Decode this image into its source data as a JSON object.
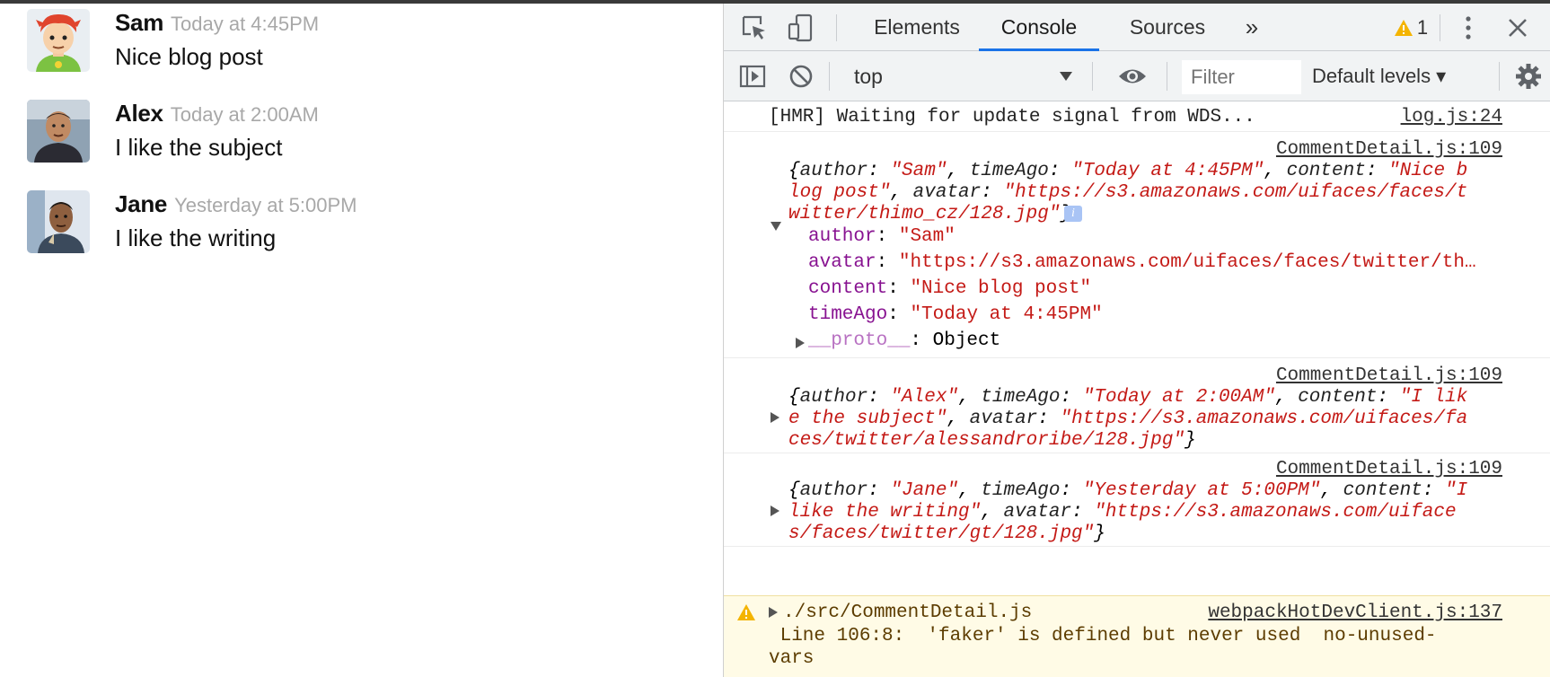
{
  "comments": [
    {
      "author": "Sam",
      "date": "Today at 4:45PM",
      "text": "Nice blog post"
    },
    {
      "author": "Alex",
      "date": "Today at 2:00AM",
      "text": "I like the subject"
    },
    {
      "author": "Jane",
      "date": "Yesterday at 5:00PM",
      "text": "I like the writing"
    }
  ],
  "devtools": {
    "tabs": [
      "Elements",
      "Console",
      "Sources"
    ],
    "more_tabs": "»",
    "warning_count": "1",
    "context": "top",
    "filter_placeholder": "Filter",
    "levels": "Default levels ▾",
    "accent": "#1a73e8"
  },
  "console": {
    "hmr": {
      "text": "[HMR] Waiting for update signal from WDS...",
      "source": "log.js:24"
    },
    "entries": [
      {
        "source": "CommentDetail.js:109",
        "lines": [
          [
            [
              "it",
              "{"
            ],
            [
              "itk",
              "author"
            ],
            [
              "it",
              ": "
            ],
            [
              "its",
              "\"Sam\""
            ],
            [
              "it",
              ", "
            ],
            [
              "itk",
              "timeAgo"
            ],
            [
              "it",
              ": "
            ],
            [
              "its",
              "\"Today at 4:45PM\""
            ],
            [
              "it",
              ", "
            ],
            [
              "itk",
              "content"
            ],
            [
              "it",
              ": "
            ],
            [
              "its",
              "\"Nice b"
            ]
          ],
          [
            [
              "its",
              "log post\""
            ],
            [
              "it",
              ", "
            ],
            [
              "itk",
              "avatar"
            ],
            [
              "it",
              ": "
            ],
            [
              "its",
              "\"https://s3.amazonaws.com/uifaces/faces/t"
            ]
          ],
          [
            [
              "its",
              "witter/thimo_cz/128.jpg\""
            ],
            [
              "it",
              "}"
            ]
          ]
        ],
        "expanded": true,
        "props": [
          {
            "key": "author",
            "value": "\"Sam\""
          },
          {
            "key": "avatar",
            "value": "\"https://s3.amazonaws.com/uifaces/faces/twitter/th…"
          },
          {
            "key": "content",
            "value": "\"Nice blog post\""
          },
          {
            "key": "timeAgo",
            "value": "\"Today at 4:45PM\""
          }
        ],
        "proto": {
          "key": "__proto__",
          "value": ": Object"
        }
      },
      {
        "source": "CommentDetail.js:109",
        "lines": [
          [
            [
              "it",
              "{"
            ],
            [
              "itk",
              "author"
            ],
            [
              "it",
              ": "
            ],
            [
              "its",
              "\"Alex\""
            ],
            [
              "it",
              ", "
            ],
            [
              "itk",
              "timeAgo"
            ],
            [
              "it",
              ": "
            ],
            [
              "its",
              "\"Today at 2:00AM\""
            ],
            [
              "it",
              ", "
            ],
            [
              "itk",
              "content"
            ],
            [
              "it",
              ": "
            ],
            [
              "its",
              "\"I lik"
            ]
          ],
          [
            [
              "its",
              "e the subject\""
            ],
            [
              "it",
              ", "
            ],
            [
              "itk",
              "avatar"
            ],
            [
              "it",
              ": "
            ],
            [
              "its",
              "\"https://s3.amazonaws.com/uifaces/fa"
            ]
          ],
          [
            [
              "its",
              "ces/twitter/alessandroribe/128.jpg\""
            ],
            [
              "it",
              "}"
            ]
          ]
        ],
        "expanded": false
      },
      {
        "source": "CommentDetail.js:109",
        "lines": [
          [
            [
              "it",
              "{"
            ],
            [
              "itk",
              "author"
            ],
            [
              "it",
              ": "
            ],
            [
              "its",
              "\"Jane\""
            ],
            [
              "it",
              ", "
            ],
            [
              "itk",
              "timeAgo"
            ],
            [
              "it",
              ": "
            ],
            [
              "its",
              "\"Yesterday at 5:00PM\""
            ],
            [
              "it",
              ", "
            ],
            [
              "itk",
              "content"
            ],
            [
              "it",
              ": "
            ],
            [
              "its",
              "\"I"
            ]
          ],
          [
            [
              "its",
              "like the writing\""
            ],
            [
              "it",
              ", "
            ],
            [
              "itk",
              "avatar"
            ],
            [
              "it",
              ": "
            ],
            [
              "its",
              "\"https://s3.amazonaws.com/uiface"
            ]
          ],
          [
            [
              "its",
              "s/faces/twitter/gt/128.jpg\""
            ],
            [
              "it",
              "}"
            ]
          ]
        ],
        "expanded": false
      }
    ],
    "warning": {
      "file": "./src/CommentDetail.js",
      "source": "webpackHotDevClient.js:137",
      "line1": " Line 106:8:  'faker' is defined but never used  no-unused-",
      "line2": "vars"
    }
  }
}
